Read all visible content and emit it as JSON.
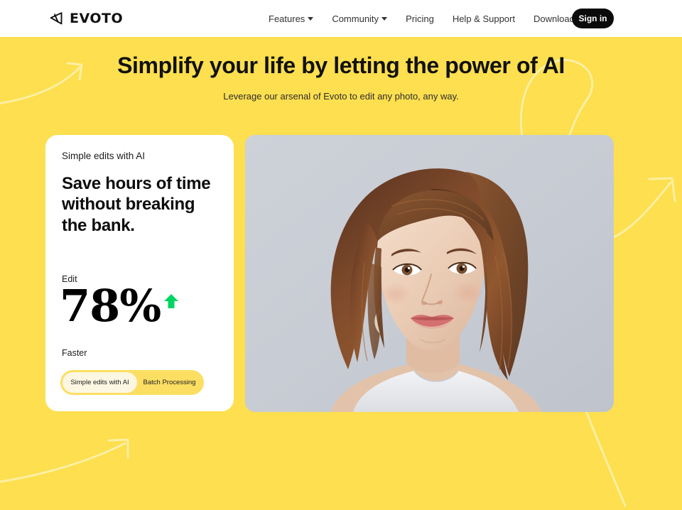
{
  "brand": {
    "name": "EVOTO",
    "logo_icon": "evoto-triangle-mark"
  },
  "nav": {
    "items": [
      {
        "label": "Features",
        "has_dropdown": true
      },
      {
        "label": "Community",
        "has_dropdown": true
      },
      {
        "label": "Pricing",
        "has_dropdown": false
      },
      {
        "label": "Help & Support",
        "has_dropdown": false
      },
      {
        "label": "Download",
        "has_dropdown": false
      }
    ],
    "signin_label": "Sign in"
  },
  "hero": {
    "title": "Simplify your life by letting the power of AI",
    "subtitle": "Leverage our arsenal of Evoto to edit any photo, any way."
  },
  "card": {
    "eyebrow": "Simple edits with AI",
    "headline": "Save hours of time without breaking the bank.",
    "stat_prefix": "Edit",
    "stat_value": "78%",
    "stat_suffix": "Faster",
    "trend_icon": "up-arrow-icon",
    "toggle": {
      "active_label": "Simple edits with AI",
      "inactive_label": "Batch Processing"
    }
  },
  "photo": {
    "alt": "Portrait of a woman with long brown hair wearing a white tank top on a light gray background"
  },
  "colors": {
    "background_yellow": "#FDDF4F",
    "header_white": "#FFFFFF",
    "card_white": "#FFFFFF",
    "signin_black": "#0B0B0B",
    "trend_green": "#00D563",
    "toggle_track": "#FCDE62",
    "toggle_active": "#FDF7E2",
    "photo_bg_gray": "#C9CDD4",
    "decor_line": "#FDEFA3"
  }
}
